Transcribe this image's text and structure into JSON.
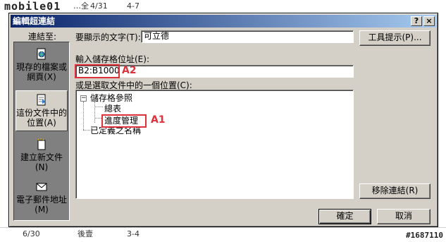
{
  "background": {
    "logo_text": "mobile01",
    "top_cells": [
      "4/31",
      "…全",
      "4-7"
    ],
    "bottom_cells": [
      "6/30",
      "後壹",
      "3-4"
    ],
    "watermark": "#1687110"
  },
  "dialog": {
    "title": "編輯超連結",
    "help_button": "?",
    "close_button": "×",
    "link_to_label": "連結至:",
    "link_items": [
      {
        "label": "現存的檔案或網頁(X)",
        "icon": "existing-file-icon"
      },
      {
        "label": "這份文件中的位置(A)",
        "icon": "place-in-document-icon"
      },
      {
        "label": "建立新文件(N)",
        "icon": "new-document-icon"
      },
      {
        "label": "電子郵件地址(M)",
        "icon": "email-address-icon"
      }
    ],
    "selected_link_index": 1,
    "display_text_label": "要顯示的文字(T):",
    "display_text_value": "可立德",
    "screentip_button": "工具提示(P)...",
    "cell_ref_label": "輸入儲存格位址(E):",
    "cell_ref_value": "B2:B1000",
    "place_label": "或是選取文件中的一個位置(C):",
    "tree": {
      "root_cell_refs": "儲存格參照",
      "sheet_1": "總表",
      "sheet_2": "進度管理",
      "root_defined_names": "已定義之名稱"
    },
    "remove_link_button": "移除連結(R)",
    "ok_button": "確定",
    "cancel_button": "取消"
  },
  "annotations": {
    "a1": "A1",
    "a2": "A2"
  },
  "colors": {
    "title_start": "#0a246a",
    "title_end": "#a6caf0",
    "dialog_face": "#d4d0c8",
    "annotation": "#e0303a"
  }
}
